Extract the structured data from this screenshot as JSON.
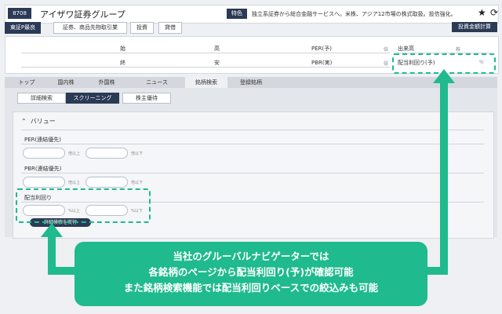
{
  "header": {
    "code": "8708",
    "company_name": "アイザワ証券グループ",
    "feature_badge": "特色",
    "feature_text": "独立系証券から総合金融サービスへ。米株、アジア12市場の株式取扱。投信強化。",
    "star_icon": "star-icon",
    "refresh_icon": "refresh-icon"
  },
  "subnav": {
    "items": [
      "東証P最良",
      "証券、商品先物取引業",
      "投資",
      "貸借"
    ],
    "calc_button": "投資金額計算"
  },
  "prices": {
    "open_label": "始",
    "high_label": "高",
    "close_label": "終",
    "low_label": "安",
    "per_label": "PER(予)",
    "per_unit": "倍",
    "pbr_label": "PBR(実)",
    "pbr_unit": "倍",
    "volume_label": "出来高",
    "volume_unit": "株",
    "yield_label": "配当利回り(予)",
    "yield_unit": "%"
  },
  "tabs": [
    "トップ",
    "国内株",
    "外国株",
    "ニュース",
    "銘柄検索",
    "登録銘柄"
  ],
  "screening_tabs": [
    "詳細検索",
    "スクリーニング",
    "株主優待"
  ],
  "valuation": {
    "title": "バリュー",
    "per_label": "PER(連結優先)",
    "per_min_unit": "倍以上",
    "per_max_unit": "倍以下",
    "pbr_label": "PBR(連結優先)",
    "pbr_min_unit": "倍以上",
    "pbr_max_unit": "倍以下",
    "yield_label": "配当利回り",
    "yield_min_unit": "%以上",
    "yield_max_unit": "%以下",
    "run_button": "詳細検索を実行"
  },
  "callout": {
    "line1": "当社のグルーバルナビゲーターでは",
    "line2": "各銘柄のページから配当利回り(予)が確認可能",
    "line3": "また銘柄検索機能では配当利回りベースでの絞込みも可能"
  },
  "colors": {
    "accent": "#1fba8d",
    "navy": "#2b3a55"
  }
}
